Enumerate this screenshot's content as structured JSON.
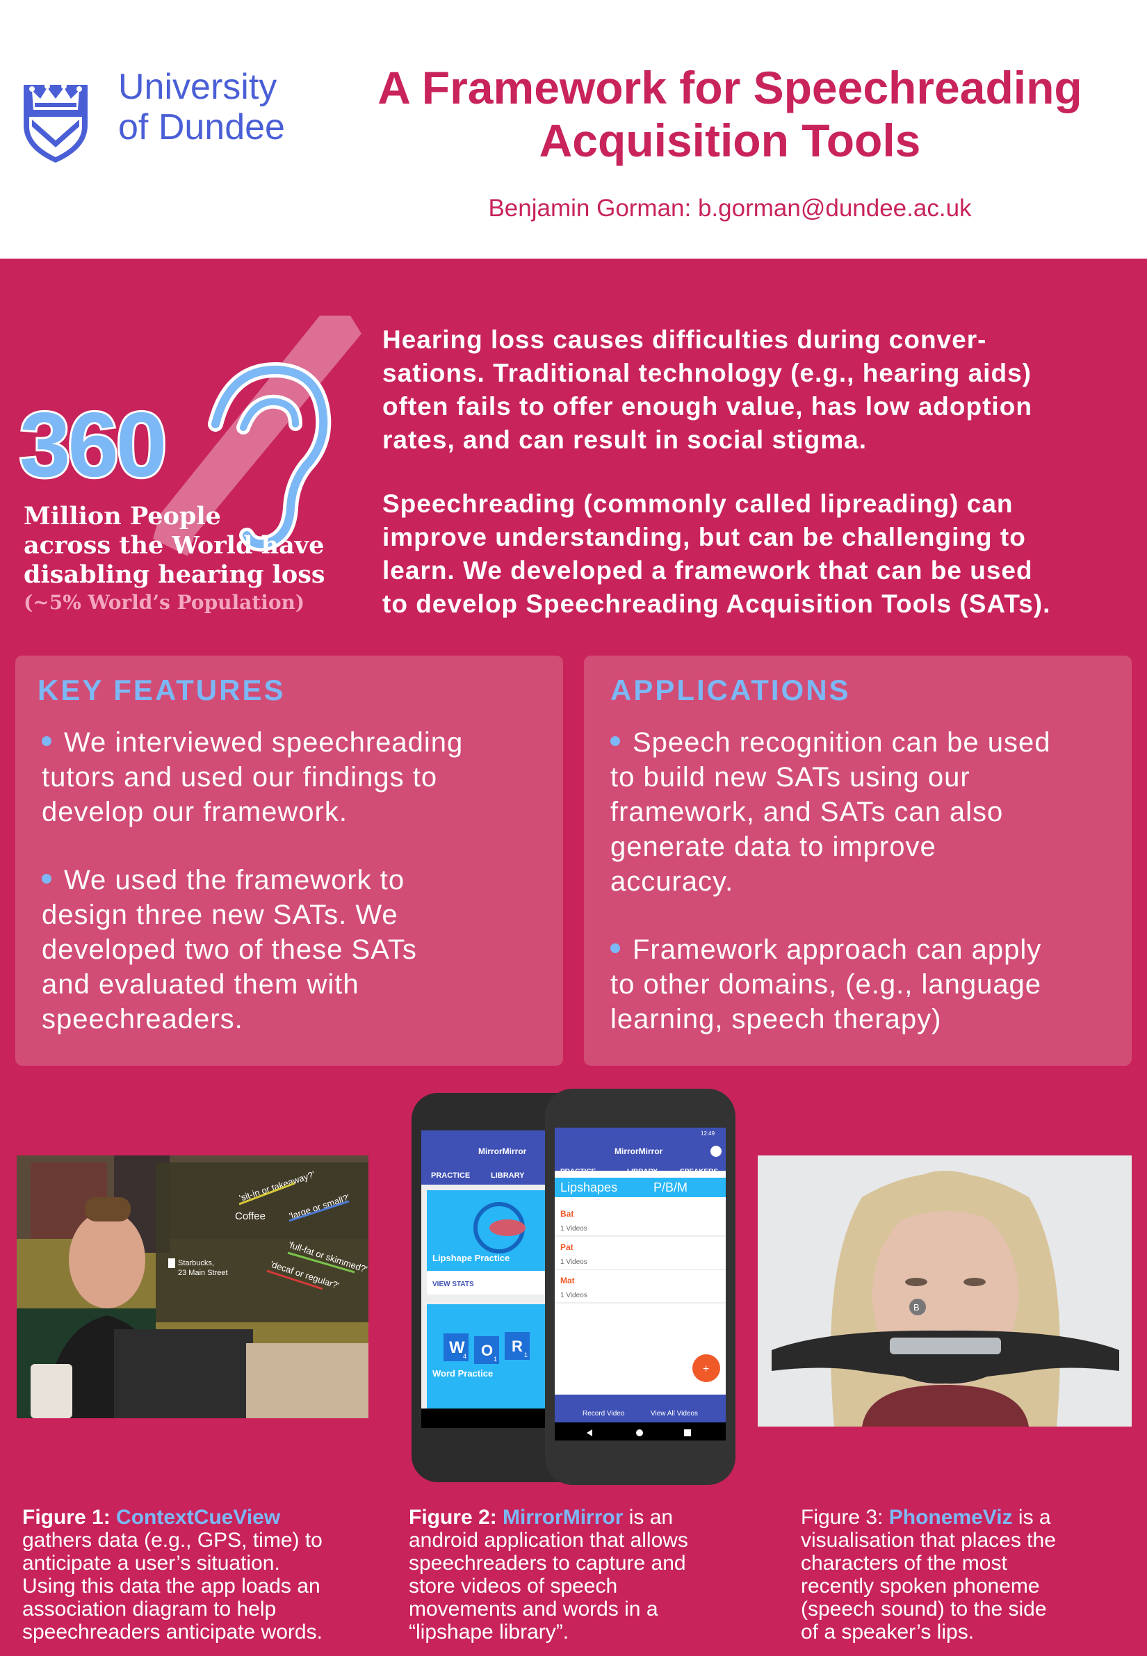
{
  "header": {
    "university_line1": "University",
    "university_line2": "of Dundee",
    "title_line1": "A Framework for Speechreading",
    "title_line2": "Acquisition Tools",
    "author": "Benjamin Gorman: b.gorman@dundee.ac.uk"
  },
  "stat": {
    "number": "360",
    "line1": "Million People",
    "line2": "across the World have",
    "line3": "disabling hearing loss",
    "sub": "(~5% World’s Population)"
  },
  "intro": {
    "p1_lines": [
      "Hearing loss causes difficulties during conver-",
      "sations. Traditional technology (e.g., hearing aids)",
      "often fails to offer enough value, has low adoption",
      "rates, and can result in social stigma."
    ],
    "p2_lines": [
      "Speechreading (commonly called lipreading) can",
      "improve understanding, but can be challenging to",
      "learn. We developed a framework that can be used",
      "to develop Speechreading Acquisition Tools (SATs)."
    ]
  },
  "key_features": {
    "title": "KEY FEATURES",
    "b1": [
      "We interviewed speechreading",
      "tutors and used our findings to",
      "develop our framework."
    ],
    "b2": [
      "We used the framework to",
      "design three new SATs. We",
      "developed two of these SATs",
      "and evaluated them with",
      "speechreaders."
    ]
  },
  "applications": {
    "title": "APPLICATIONS",
    "b1": [
      "Speech recognition can be used",
      "to build new SATs using our",
      "framework, and SATs can also",
      "generate data to improve",
      "accuracy."
    ],
    "b2": [
      "Framework approach can apply",
      "to other domains, (e.g., language",
      "learning, speech therapy)"
    ]
  },
  "fig1": {
    "overlay_words": [
      "'sit-in or takeaway?'",
      "'large or small?'",
      "Coffee",
      "'full-fat or skimmed?'",
      "'decaf or regular?'",
      "Starbucks,",
      "23 Main Street"
    ],
    "label": "Figure 1:",
    "name": "ContextCueView",
    "lines": [
      "gathers data (e.g., GPS, time) to",
      "anticipate a user’s situation.",
      "Using this data the app loads an",
      "association diagram to help",
      "speechreaders anticipate words."
    ]
  },
  "fig2": {
    "left_phone": {
      "app": "MirrorMirror",
      "tab1": "PRACTICE",
      "tab2": "LIBRARY",
      "card1": "Lipshape Practice",
      "card1_link": "VIEW STATS",
      "card2": "Word Practice",
      "tiles": [
        "W",
        "O",
        "R"
      ],
      "tile_subs": [
        "4",
        "1",
        "1"
      ]
    },
    "right_phone": {
      "app": "MirrorMirror",
      "time": "12:49",
      "tab1": "PRACTICE",
      "tab2": "LIBRARY",
      "tab3": "SPEAKERS",
      "crumb1": "Lipshapes",
      "crumb2": "P/B/M",
      "rows": [
        {
          "title": "Bat",
          "sub": "1 Videos"
        },
        {
          "title": "Pat",
          "sub": "1 Videos"
        },
        {
          "title": "Mat",
          "sub": "1 Videos"
        }
      ],
      "fab": "+",
      "bottom1": "Record Video",
      "bottom2": "View All Videos"
    },
    "label": "Figure 2:",
    "name": "MirrorMirror",
    "first_rest": " is an",
    "lines": [
      "android application that allows",
      "speechreaders to capture and",
      "store videos of speech",
      "movements and words in a",
      "“lipshape library”."
    ]
  },
  "fig3": {
    "phoneme": "B",
    "label": "Figure 3:",
    "name": "PhonemeViz",
    "first_rest": " is a",
    "lines": [
      "visualisation that places the",
      "characters of the most",
      "recently spoken phoneme",
      "(speech sound) to the side",
      "of a speaker’s lips."
    ]
  },
  "colors": {
    "brand_crimson": "#c8235a",
    "accent_blue": "#7cb8f5",
    "university_blue": "#4a5fd6",
    "panel": "#d14d75"
  }
}
